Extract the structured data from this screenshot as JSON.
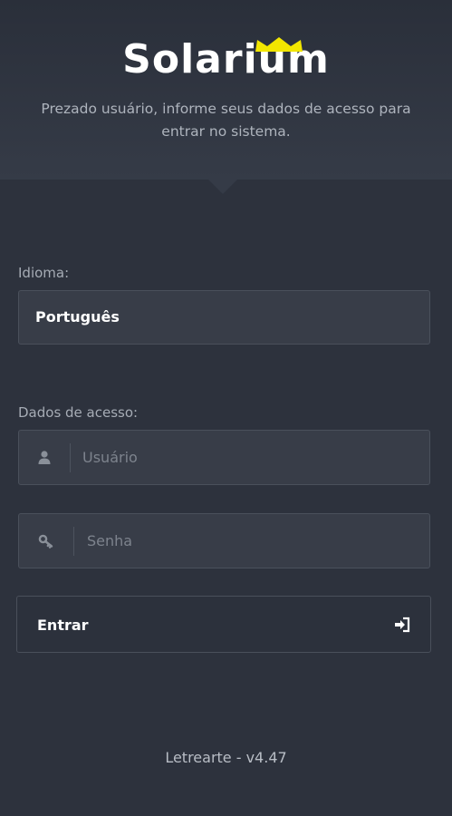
{
  "brand": {
    "name": "Solarium",
    "accent_color": "#f2e600"
  },
  "intro": {
    "text": "Prezado usuário, informe seus dados de acesso para entrar no sistema."
  },
  "language": {
    "label": "Idioma:",
    "selected": "Português"
  },
  "credentials": {
    "label": "Dados de acesso:",
    "username_placeholder": "Usuário",
    "username_icon": "user-icon",
    "password_placeholder": "Senha",
    "password_icon": "key-icon"
  },
  "login_button": {
    "label": "Entrar",
    "icon": "sign-in-icon"
  },
  "footer": {
    "version": "Letrearte - v4.47"
  },
  "colors": {
    "background": "#2d323d",
    "header": "#353b47",
    "field": "#383d48"
  }
}
